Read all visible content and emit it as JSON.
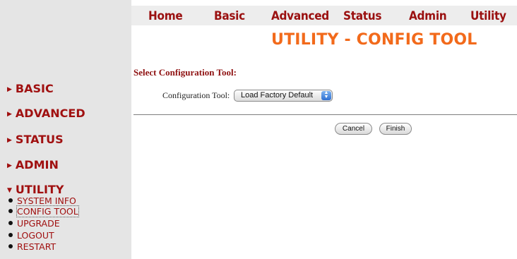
{
  "top_nav": [
    "Home",
    "Basic",
    "Advanced",
    "Status",
    "Admin",
    "Utility"
  ],
  "page_title": "UTILITY - CONFIG TOOL",
  "section_title": "Select Configuration Tool:",
  "config_tool": {
    "label": "Configuration Tool:",
    "selected": "Load Factory Default"
  },
  "buttons": {
    "cancel": "Cancel",
    "finish": "Finish"
  },
  "sidebar": {
    "menus": [
      "BASIC",
      "ADVANCED",
      "STATUS",
      "ADMIN",
      "UTILITY"
    ],
    "utility_items": [
      "SYSTEM INFO",
      "CONFIG TOOL",
      "UPGRADE",
      "LOGOUT",
      "RESTART"
    ],
    "active_item": "CONFIG TOOL"
  },
  "colors": {
    "brand": "#9a1010",
    "title": "#f26a1b",
    "sidebar_bg": "#e5e5e5"
  },
  "icons": {
    "collapsed": "triangle-right-icon",
    "expanded": "triangle-down-icon",
    "bullet": "bullet-icon",
    "select_arrows": "up-down-arrows-icon"
  }
}
